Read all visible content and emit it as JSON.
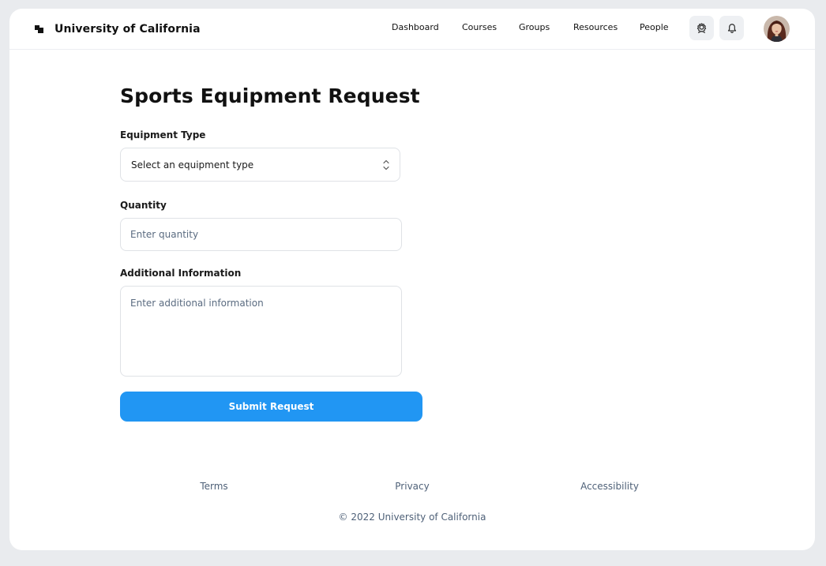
{
  "header": {
    "brand": "University of California",
    "nav": [
      "Dashboard",
      "Courses",
      "Groups",
      "Resources",
      "People"
    ],
    "icons": {
      "settings": "user-settings-icon",
      "notifications": "bell-icon",
      "avatar": "avatar"
    }
  },
  "main": {
    "title": "Sports Equipment Request",
    "equipment_type": {
      "label": "Equipment Type",
      "selected": "Select an equipment type"
    },
    "quantity": {
      "label": "Quantity",
      "placeholder": "Enter quantity"
    },
    "additional_info": {
      "label": "Additional Information",
      "placeholder": "Enter additional information"
    },
    "submit_label": "Submit Request"
  },
  "footer": {
    "links": [
      "Terms",
      "Privacy",
      "Accessibility"
    ],
    "copyright": "© 2022 University of California"
  },
  "colors": {
    "accent": "#2196f3",
    "background": "#e9ebee",
    "card": "#ffffff"
  }
}
